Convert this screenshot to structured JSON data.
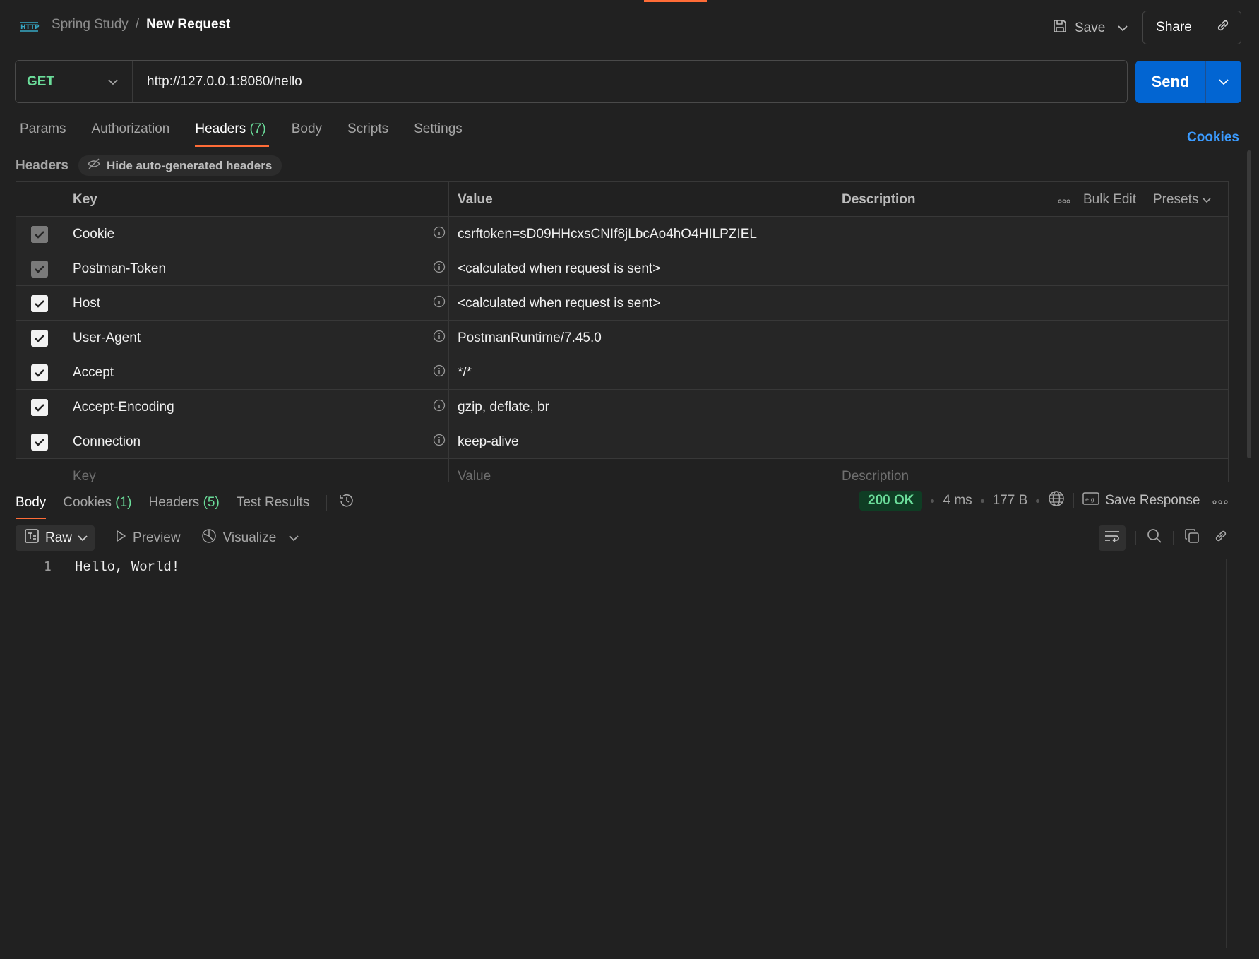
{
  "header": {
    "collection": "Spring Study",
    "separator": "/",
    "request_name": "New Request",
    "save_label": "Save",
    "share_label": "Share"
  },
  "request": {
    "method": "GET",
    "url": "http://127.0.0.1:8080/hello",
    "send_label": "Send"
  },
  "tabs": [
    {
      "label": "Params"
    },
    {
      "label": "Authorization"
    },
    {
      "label": "Headers",
      "count": "(7)",
      "active": true
    },
    {
      "label": "Body"
    },
    {
      "label": "Scripts"
    },
    {
      "label": "Settings"
    }
  ],
  "cookies_link": "Cookies",
  "headers_section": {
    "title": "Headers",
    "hide_auto_label": "Hide auto-generated headers",
    "columns": {
      "key": "Key",
      "value": "Value",
      "description": "Description"
    },
    "bulk_edit": "Bulk Edit",
    "presets": "Presets",
    "rows": [
      {
        "key": "Cookie",
        "value": "csrftoken=sD09HHcxsCNIf8jLbcAo4hO4HILPZIEL",
        "checked_dim": true
      },
      {
        "key": "Postman-Token",
        "value": "<calculated when request is sent>",
        "checked_dim": true
      },
      {
        "key": "Host",
        "value": "<calculated when request is sent>",
        "checked_dim": false
      },
      {
        "key": "User-Agent",
        "value": "PostmanRuntime/7.45.0",
        "checked_dim": false
      },
      {
        "key": "Accept",
        "value": "*/*",
        "checked_dim": false
      },
      {
        "key": "Accept-Encoding",
        "value": "gzip, deflate, br",
        "checked_dim": false
      },
      {
        "key": "Connection",
        "value": "keep-alive",
        "checked_dim": false
      }
    ],
    "new_row": {
      "key_placeholder": "Key",
      "value_placeholder": "Value",
      "description_placeholder": "Description"
    }
  },
  "response": {
    "tabs": [
      {
        "label": "Body",
        "active": true
      },
      {
        "label": "Cookies",
        "count": "(1)"
      },
      {
        "label": "Headers",
        "count": "(5)"
      },
      {
        "label": "Test Results"
      }
    ],
    "status": "200 OK",
    "time": "4 ms",
    "size": "177 B",
    "save_response": "Save Response",
    "format": "Raw",
    "preview": "Preview",
    "visualize": "Visualize",
    "lines": [
      {
        "num": "1",
        "text": "Hello, World!"
      }
    ]
  },
  "colors": {
    "accent": "#ff6c37",
    "send": "#0265d2",
    "method_green": "#6bdd9a",
    "link_blue": "#3b9bff"
  }
}
